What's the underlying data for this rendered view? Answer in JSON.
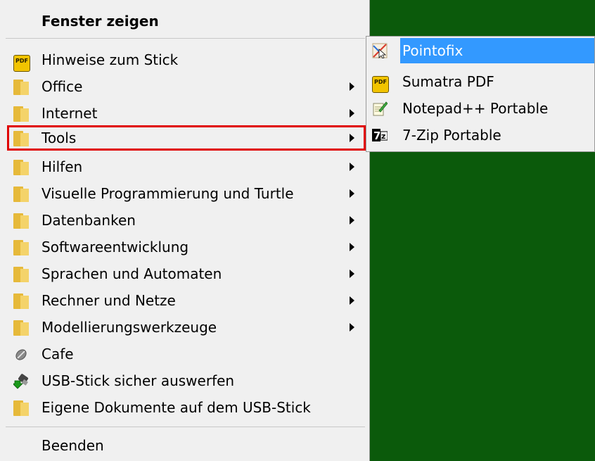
{
  "colors": {
    "desktop_background": "#0b5a0b",
    "menu_background": "#f0f0f0",
    "highlight_box": "#e00000",
    "active_item": "#3399ff"
  },
  "main_menu": {
    "header": "Fenster zeigen",
    "items": [
      {
        "label": "Hinweise zum Stick",
        "icon": "pdf-icon",
        "submenu": false
      },
      {
        "label": "Office",
        "icon": "folder-icon",
        "submenu": true
      },
      {
        "label": "Internet",
        "icon": "folder-icon",
        "submenu": true
      },
      {
        "label": "Tools",
        "icon": "folder-icon",
        "submenu": true,
        "highlighted": true
      },
      {
        "label": "Hilfen",
        "icon": "folder-icon",
        "submenu": true
      },
      {
        "label": "Visuelle Programmierung und Turtle",
        "icon": "folder-icon",
        "submenu": true
      },
      {
        "label": "Datenbanken",
        "icon": "folder-icon",
        "submenu": true
      },
      {
        "label": "Softwareentwicklung",
        "icon": "folder-icon",
        "submenu": true
      },
      {
        "label": "Sprachen und Automaten",
        "icon": "folder-icon",
        "submenu": true
      },
      {
        "label": "Rechner und Netze",
        "icon": "folder-icon",
        "submenu": true
      },
      {
        "label": "Modellierungswerkzeuge",
        "icon": "folder-icon",
        "submenu": true
      },
      {
        "label": "Cafe",
        "icon": "coffee-bean-icon",
        "submenu": false
      },
      {
        "label": "USB-Stick sicher auswerfen",
        "icon": "usb-eject-icon",
        "submenu": false
      },
      {
        "label": "Eigene Dokumente auf dem USB-Stick",
        "icon": "folder-icon",
        "submenu": false
      }
    ],
    "exit_label": "Beenden"
  },
  "tools_submenu": {
    "items": [
      {
        "label": "Pointofix",
        "icon": "pointofix-icon",
        "active": true
      },
      {
        "label": "Sumatra PDF",
        "icon": "pdf-icon",
        "active": false
      },
      {
        "label": "Notepad++ Portable",
        "icon": "notepad-icon",
        "active": false
      },
      {
        "label": "7-Zip Portable",
        "icon": "seven-zip-icon",
        "active": false
      }
    ]
  }
}
